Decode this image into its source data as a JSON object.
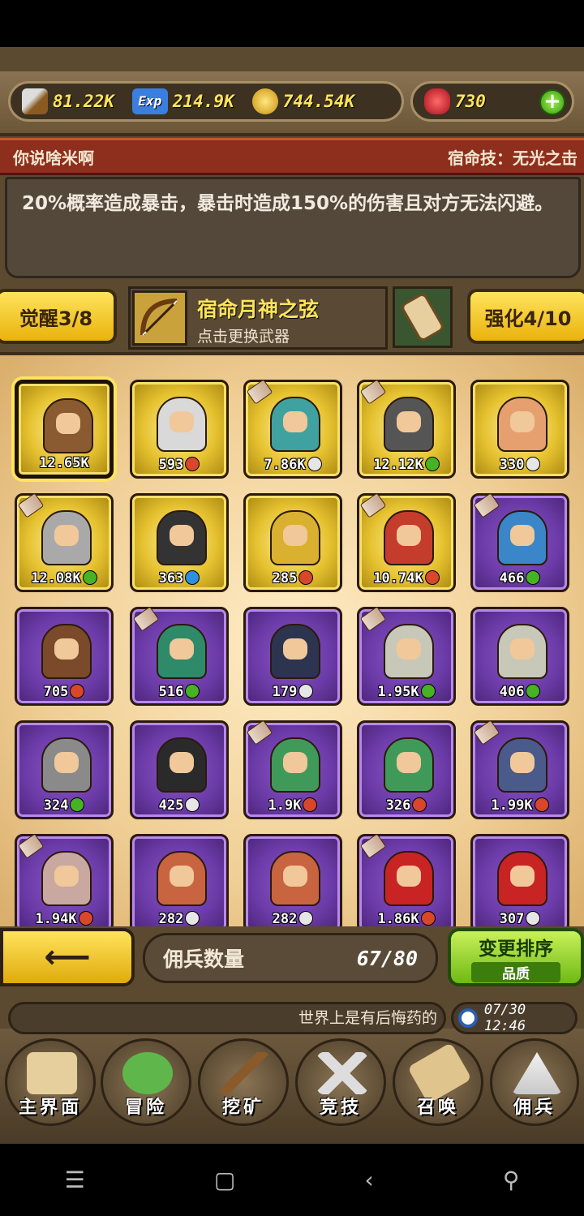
{
  "resources": {
    "attack": "81.22K",
    "exp": "214.9K",
    "gold": "744.54K",
    "gems": "730"
  },
  "hero": {
    "name": "你说啥米啊",
    "fate_skill": "宿命技：无光之击",
    "description": "20%概率造成暴击，暴击时造成150%的伤害且对方无法闪避。"
  },
  "weapon": {
    "awaken": "觉醒3/8",
    "name": "宿命月神之弦",
    "subtitle": "点击更换武器",
    "enhance": "强化4/10"
  },
  "mercenaries": [
    {
      "level": "12.65K",
      "rarity": "gold",
      "badge": "",
      "weapon": false,
      "selected": true,
      "color": "#8a5a30"
    },
    {
      "level": "593",
      "rarity": "gold",
      "badge": "red",
      "weapon": false,
      "selected": false,
      "color": "#d9d9d9"
    },
    {
      "level": "7.86K",
      "rarity": "gold",
      "badge": "q",
      "weapon": true,
      "selected": false,
      "color": "#3fa2a0"
    },
    {
      "level": "12.12K",
      "rarity": "gold",
      "badge": "green",
      "weapon": true,
      "selected": false,
      "color": "#555555"
    },
    {
      "level": "330",
      "rarity": "gold",
      "badge": "q",
      "weapon": false,
      "selected": false,
      "color": "#e6a070"
    },
    {
      "level": "12.08K",
      "rarity": "gold",
      "badge": "green",
      "weapon": true,
      "selected": false,
      "color": "#a9a9a9"
    },
    {
      "level": "363",
      "rarity": "gold",
      "badge": "blue",
      "weapon": false,
      "selected": false,
      "color": "#333333"
    },
    {
      "level": "285",
      "rarity": "gold",
      "badge": "red",
      "weapon": false,
      "selected": false,
      "color": "#d9b030"
    },
    {
      "level": "10.74K",
      "rarity": "gold",
      "badge": "red",
      "weapon": true,
      "selected": false,
      "color": "#c43c2c"
    },
    {
      "level": "466",
      "rarity": "purple",
      "badge": "green",
      "weapon": true,
      "selected": false,
      "color": "#3a86c8"
    },
    {
      "level": "705",
      "rarity": "purple",
      "badge": "red",
      "weapon": false,
      "selected": false,
      "color": "#7a4a2a"
    },
    {
      "level": "516",
      "rarity": "purple",
      "badge": "green",
      "weapon": true,
      "selected": false,
      "color": "#2f8a6a"
    },
    {
      "level": "179",
      "rarity": "purple",
      "badge": "q",
      "weapon": false,
      "selected": false,
      "color": "#2c3450"
    },
    {
      "level": "1.95K",
      "rarity": "purple",
      "badge": "green",
      "weapon": true,
      "selected": false,
      "color": "#c8c8b8"
    },
    {
      "level": "406",
      "rarity": "purple",
      "badge": "green",
      "weapon": false,
      "selected": false,
      "color": "#c8c8b8"
    },
    {
      "level": "324",
      "rarity": "purple",
      "badge": "green",
      "weapon": false,
      "selected": false,
      "color": "#8a8a8a"
    },
    {
      "level": "425",
      "rarity": "purple",
      "badge": "q",
      "weapon": false,
      "selected": false,
      "color": "#2a2a2a"
    },
    {
      "level": "1.9K",
      "rarity": "purple",
      "badge": "red",
      "weapon": true,
      "selected": false,
      "color": "#3f9a5a"
    },
    {
      "level": "326",
      "rarity": "purple",
      "badge": "red",
      "weapon": false,
      "selected": false,
      "color": "#3f9a5a"
    },
    {
      "level": "1.99K",
      "rarity": "purple",
      "badge": "red",
      "weapon": true,
      "selected": false,
      "color": "#4a5a8a"
    },
    {
      "level": "1.94K",
      "rarity": "purple",
      "badge": "red",
      "weapon": true,
      "selected": false,
      "color": "#c8a8a0"
    },
    {
      "level": "282",
      "rarity": "purple",
      "badge": "q",
      "weapon": false,
      "selected": false,
      "color": "#c86440"
    },
    {
      "level": "282",
      "rarity": "purple",
      "badge": "q",
      "weapon": false,
      "selected": false,
      "color": "#c86440"
    },
    {
      "level": "1.86K",
      "rarity": "purple",
      "badge": "red",
      "weapon": true,
      "selected": false,
      "color": "#c82424"
    },
    {
      "level": "307",
      "rarity": "purple",
      "badge": "q",
      "weapon": false,
      "selected": false,
      "color": "#c82424"
    }
  ],
  "footer": {
    "count_label": "佣兵数量",
    "count_value": "67/80",
    "sort_label": "变更排序",
    "sort_sub": "品质",
    "marquee": "世界上是有后悔药的",
    "time": "07/30 12:46"
  },
  "nav": [
    {
      "label": "主界面",
      "icon": "map-scroll-icon"
    },
    {
      "label": "冒险",
      "icon": "island-icon"
    },
    {
      "label": "挖矿",
      "icon": "pickaxe-icon"
    },
    {
      "label": "竞技",
      "icon": "crossed-swords-icon"
    },
    {
      "label": "召唤",
      "icon": "summon-scroll-icon"
    },
    {
      "label": "佣兵",
      "icon": "tent-icon"
    }
  ],
  "colors": {
    "gold_text": "#ffe45a",
    "name_bar": "#8e2e1c",
    "gold_card": "#e6c230",
    "purple_card": "#6a3aa6"
  }
}
